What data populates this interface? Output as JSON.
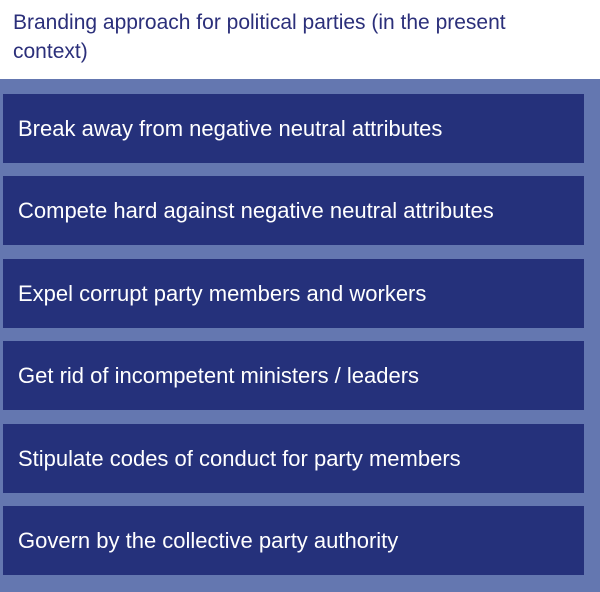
{
  "title": "Branding approach for political parties (in the present context)",
  "colors": {
    "title_text": "#2b2f7a",
    "panel_background": "#6477b0",
    "item_background": "#25317b",
    "item_text": "#ffffff"
  },
  "items": [
    "Break away from negative neutral attributes",
    "Compete hard against negative neutral attributes",
    "Expel corrupt party members and workers",
    "Get rid of incompetent ministers / leaders",
    "Stipulate codes of conduct for party members",
    "Govern by the collective party authority"
  ]
}
